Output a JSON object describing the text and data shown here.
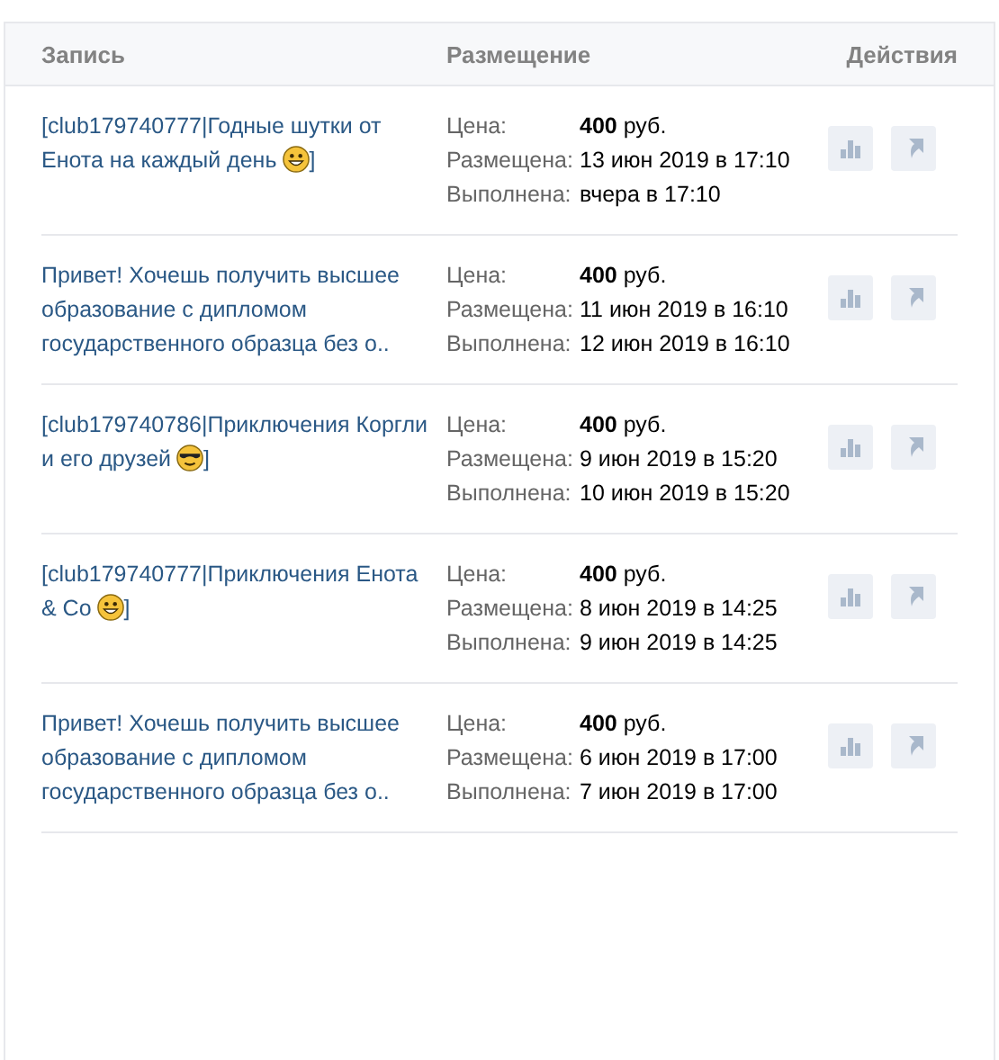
{
  "table": {
    "columns": [
      "Запись",
      "Размещение",
      "Действия"
    ],
    "rows": [
      {
        "post": {
          "segments": [
            {
              "kind": "text",
              "text": "[club179740777|Годные шутки от Енота на каждый день"
            },
            {
              "kind": "grin"
            },
            {
              "kind": "text",
              "text": "]"
            }
          ]
        },
        "details": [
          {
            "label": "Цена:",
            "amount": "400",
            "unit": "руб."
          },
          {
            "label": "Размещена:",
            "value": "13 июн 2019 в 17:10"
          },
          {
            "label": "Выполнена:",
            "value": "вчера в 17:10"
          }
        ]
      },
      {
        "post": {
          "text": "Привет! Хочешь получить высшее образование с дипломом государственного образца без о.."
        },
        "details": [
          {
            "label": "Цена:",
            "amount": "400",
            "unit": "руб."
          },
          {
            "label": "Размещена:",
            "value": "11 июн 2019 в 16:10"
          },
          {
            "label": "Выполнена:",
            "value": "12 июн 2019 в 16:10"
          }
        ]
      },
      {
        "post": {
          "segments": [
            {
              "kind": "text",
              "text": "[club179740786|Приключения Коргли и его друзей"
            },
            {
              "kind": "glasses"
            },
            {
              "kind": "text",
              "text": "]"
            }
          ]
        },
        "details": [
          {
            "label": "Цена:",
            "amount": "400",
            "unit": "руб."
          },
          {
            "label": "Размещена:",
            "value": "9 июн 2019 в 15:20"
          },
          {
            "label": "Выполнена:",
            "value": "10 июн 2019 в 15:20"
          }
        ]
      },
      {
        "post": {
          "segments": [
            {
              "kind": "text",
              "text": "[club179740777|Приключения Енота & Co"
            },
            {
              "kind": "grin"
            },
            {
              "kind": "text",
              "text": "]"
            }
          ]
        },
        "details": [
          {
            "label": "Цена:",
            "amount": "400",
            "unit": "руб."
          },
          {
            "label": "Размещена:",
            "value": "8 июн 2019 в 14:25"
          },
          {
            "label": "Выполнена:",
            "value": "9 июн 2019 в 14:25"
          }
        ]
      },
      {
        "post": {
          "text": "Привет! Хочешь получить высшее образование с дипломом государственного образца без о.."
        },
        "details": [
          {
            "label": "Цена:",
            "amount": "400",
            "unit": "руб."
          },
          {
            "label": "Размещена:",
            "value": "6 июн 2019 в 17:00"
          },
          {
            "label": "Выполнена:",
            "value": "7 июн 2019 в 17:00"
          }
        ]
      }
    ]
  }
}
